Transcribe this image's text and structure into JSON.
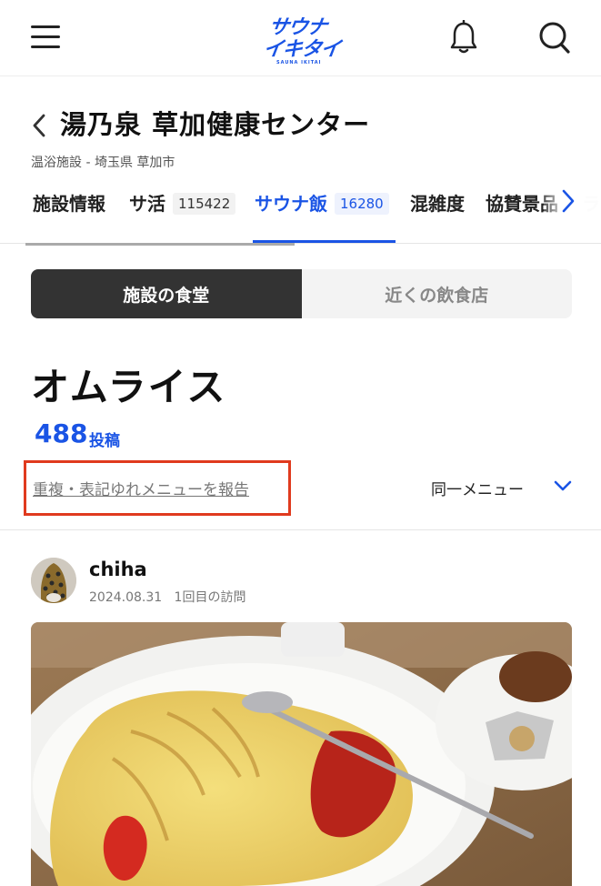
{
  "header": {
    "logo_line1": "サウナ",
    "logo_line2": "イキタイ",
    "logo_sub": "SAUNA IKITAI"
  },
  "facility": {
    "name": "湯乃泉 草加健康センター",
    "category": "温浴施設 - 埼玉県 草加市"
  },
  "tabs": [
    {
      "label": "施設情報",
      "count": ""
    },
    {
      "label": "サ活",
      "count": "115422"
    },
    {
      "label": "サウナ飯",
      "count": "16280"
    },
    {
      "label": "混雑度",
      "count": ""
    },
    {
      "label": "協賛景品",
      "count": ""
    },
    {
      "label": "ラ",
      "count": ""
    }
  ],
  "segment": {
    "option1": "施設の食堂",
    "option2": "近くの飲食店"
  },
  "menu": {
    "name": "オムライス",
    "post_count": "488",
    "post_unit": "投稿",
    "report_link": "重複・表記ゆれメニューを報告",
    "same_menu": "同一メニュー"
  },
  "post": {
    "user": "chiha",
    "date": "2024.08.31",
    "visit": "1回目の訪問"
  },
  "colors": {
    "accent": "#1a54e5",
    "highlight_box": "#e03a1e",
    "segment_active": "#333333"
  }
}
